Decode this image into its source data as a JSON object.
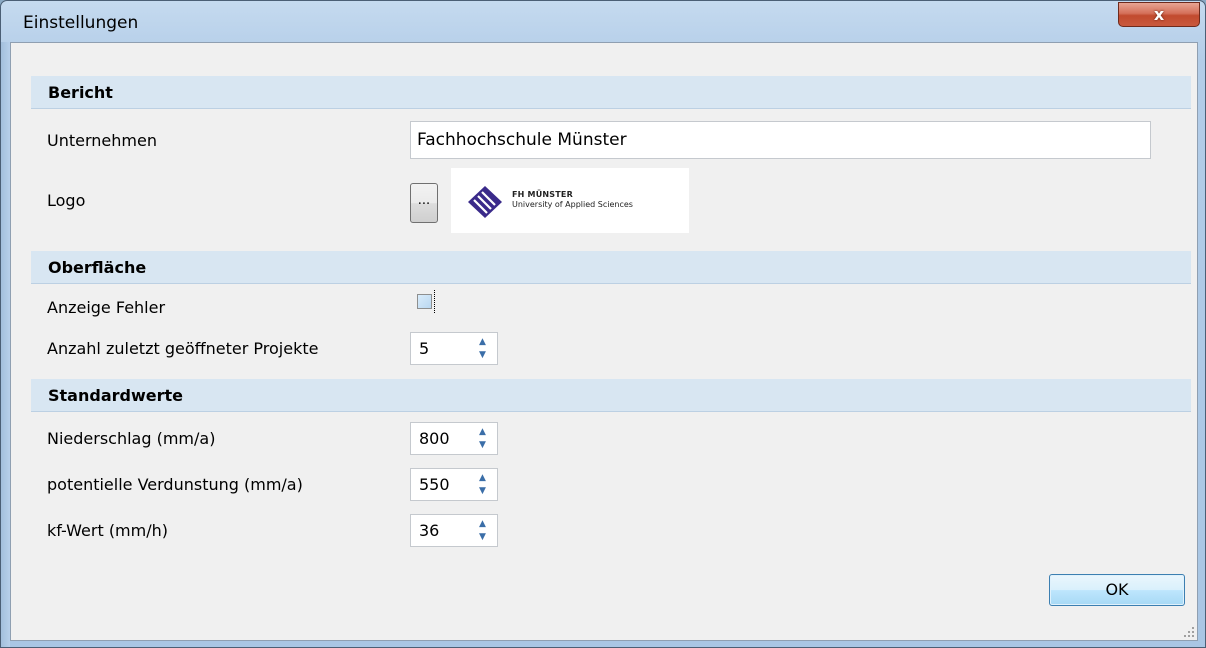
{
  "window": {
    "title": "Einstellungen",
    "close_symbol": "x"
  },
  "sections": {
    "bericht": "Bericht",
    "oberflaeche": "Oberfläche",
    "standardwerte": "Standardwerte"
  },
  "bericht": {
    "unternehmen_label": "Unternehmen",
    "unternehmen_value": "Fachhochschule Münster",
    "logo_label": "Logo",
    "browse_label": "...",
    "logo_text_line1": "FH MÜNSTER",
    "logo_text_line2": "University of Applied Sciences"
  },
  "oberflaeche": {
    "anzeige_fehler_label": "Anzeige Fehler",
    "anzeige_fehler_checked": false,
    "anzahl_projekte_label": "Anzahl zuletzt geöffneter Projekte",
    "anzahl_projekte_value": "5"
  },
  "standardwerte": {
    "niederschlag_label": "Niederschlag (mm/a)",
    "niederschlag_value": "800",
    "verdunstung_label": "potentielle Verdunstung (mm/a)",
    "verdunstung_value": "550",
    "kf_label": "kf-Wert (mm/h)",
    "kf_value": "36"
  },
  "buttons": {
    "ok": "OK"
  },
  "icons": {
    "logo": "fh-muenster-logo-icon",
    "spin_up": "chevron-up-icon",
    "spin_down": "chevron-down-icon",
    "close": "close-icon",
    "grip": "resize-grip-icon"
  },
  "colors": {
    "section_bg": "#d8e6f2",
    "logo_purple": "#3a2a8a",
    "ok_border": "#3c7fb1",
    "close_red": "#c14a2e"
  }
}
